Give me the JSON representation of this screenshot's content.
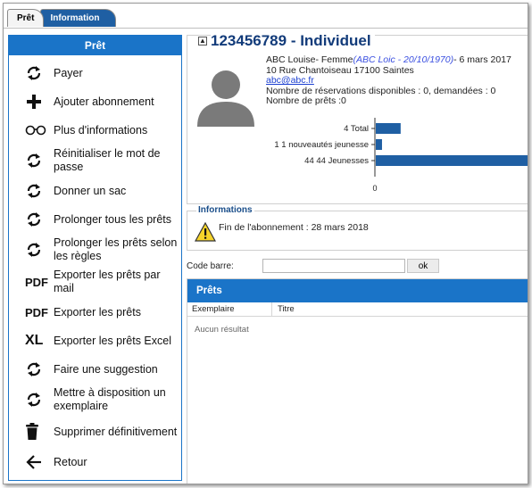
{
  "tabs": [
    {
      "label": "Prêt",
      "active": true
    },
    {
      "label": "Information",
      "active": false
    }
  ],
  "sidebar": {
    "title": "Prêt",
    "items": [
      {
        "label": "Payer",
        "icon": "refresh-icon"
      },
      {
        "label": "Ajouter abonnement",
        "icon": "plus-icon"
      },
      {
        "label": "Plus d'informations",
        "icon": "glasses-icon"
      },
      {
        "label": "Réinitialiser le mot de passe",
        "icon": "refresh-icon"
      },
      {
        "label": "Donner un sac",
        "icon": "refresh-icon"
      },
      {
        "label": "Prolonger tous les prêts",
        "icon": "refresh-icon"
      },
      {
        "label": "Prolonger les prêts selon les règles",
        "icon": "refresh-icon"
      },
      {
        "label": "Exporter les prêts par mail",
        "icon": "pdf-icon",
        "icon_text": "PDF"
      },
      {
        "label": "Exporter les prêts",
        "icon": "pdf-icon",
        "icon_text": "PDF"
      },
      {
        "label": "Exporter les prêts Excel",
        "icon": "excel-icon",
        "icon_text": "XL"
      },
      {
        "label": "Faire une suggestion",
        "icon": "refresh-icon"
      },
      {
        "label": "Mettre à disposition un exemplaire",
        "icon": "refresh-icon"
      },
      {
        "label": "Supprimer définitivement",
        "icon": "trash-icon"
      },
      {
        "label": "Retour",
        "icon": "arrow-left-icon"
      }
    ]
  },
  "patron": {
    "collapse_icon": "▲",
    "title": "123456789 - Individuel",
    "name_line": "ABC Louise- Femme",
    "alt_name": "(ABC Loic - 20/10/1970)",
    "date_suffix": "- 6 mars 2017",
    "address": "10 Rue Chantoiseau 17100 Saintes",
    "email": "abc@abc.fr",
    "reservations": "Nombre de réservations disponibles : 0, demandées : 0",
    "loans_count": "Nombre de prêts :0"
  },
  "chart_data": {
    "type": "bar",
    "orientation": "horizontal",
    "categories": [
      "4 Total",
      "1 1 nouveautés jeunesse",
      "44 44 Jeunesses"
    ],
    "values": [
      4,
      1,
      44
    ],
    "xlim": [
      0,
      25
    ],
    "x_ticks": [
      "0"
    ],
    "color": "#1f5fa3"
  },
  "informations": {
    "legend": "Informations",
    "message": "Fin de l'abonnement : 28 mars 2018"
  },
  "barcode": {
    "label": "Code barre:",
    "value": "",
    "button": "ok"
  },
  "loans": {
    "title": "Prêts",
    "columns": [
      "Exemplaire",
      "Titre"
    ],
    "empty": "Aucun résultat"
  },
  "colors": {
    "accent": "#1a74c8",
    "title": "#123b7a",
    "bar": "#1f5fa3"
  }
}
